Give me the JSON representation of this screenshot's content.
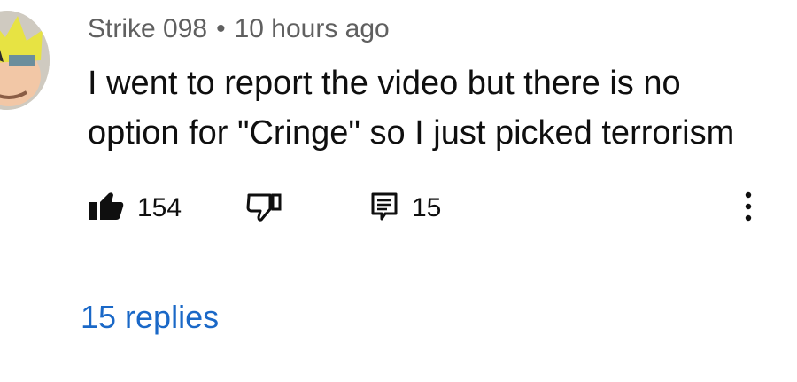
{
  "comment": {
    "author": "Strike 098",
    "separator": "•",
    "timestamp": "10 hours ago",
    "text": "I went to report the video but there is no option for \"Cringe\" so I just picked terrorism",
    "avatar_icon": "user-avatar-icon"
  },
  "actions": {
    "like_icon": "thumbs-up-filled-icon",
    "like_count": "154",
    "dislike_icon": "thumbs-down-outline-icon",
    "reply_icon": "comment-reply-icon",
    "reply_count": "15",
    "more_icon": "more-vertical-icon"
  },
  "replies": {
    "label": "15 replies",
    "color": "#1a68c7"
  }
}
